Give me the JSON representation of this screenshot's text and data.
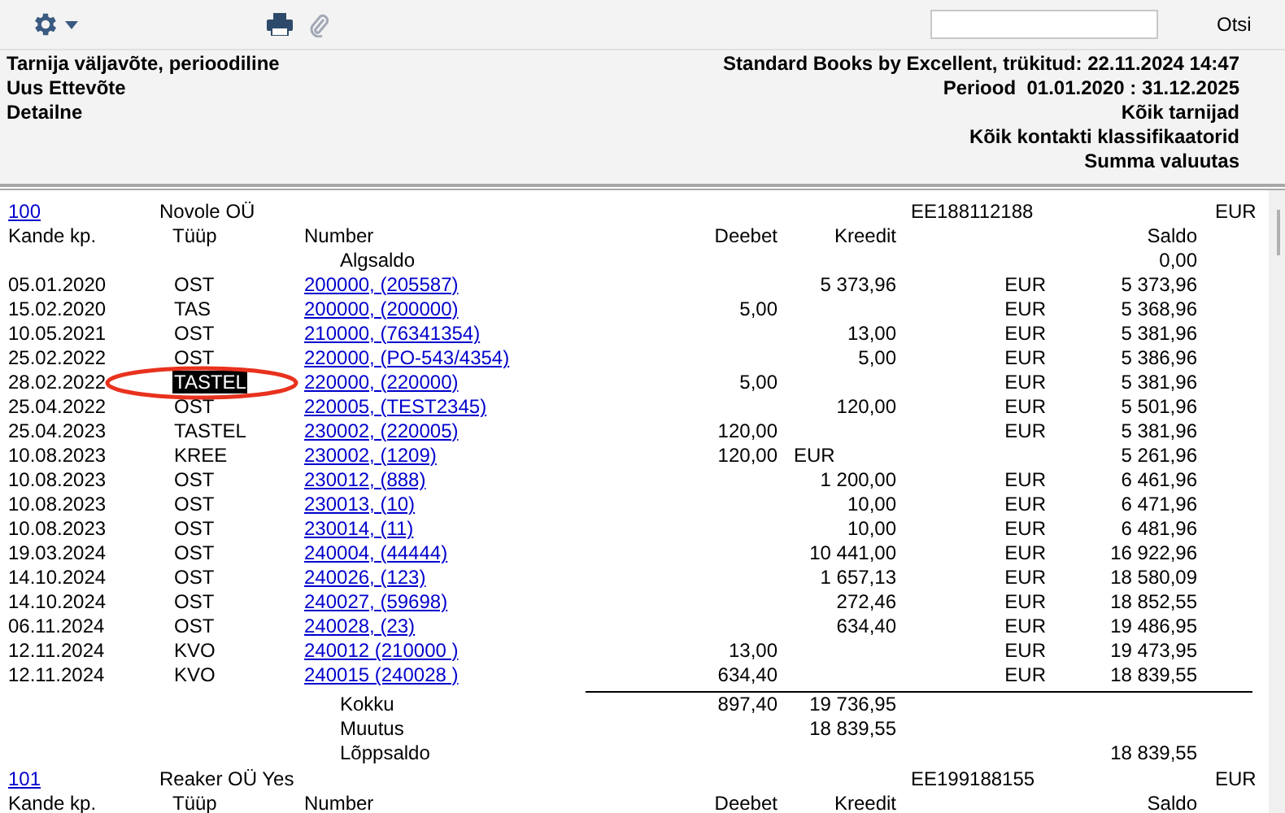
{
  "toolbar": {
    "search_button": "Otsi"
  },
  "report_header": {
    "left": [
      "Tarnija väljavõte, perioodiline",
      "Uus Ettevõte",
      "Detailne"
    ],
    "right": [
      "Standard Books by Excellent, trükitud: 22.11.2024 14:47",
      "Periood  01.01.2020 : 31.12.2025",
      "Kõik tarnijad",
      "Kõik kontakti klassifikaatorid",
      "Summa valuutas"
    ]
  },
  "groups": [
    {
      "code": "100",
      "name": "Novole OÜ",
      "vat_number": "EE188112188",
      "currency": "EUR",
      "columns": [
        "Kande kp.",
        "Tüüp",
        "Number",
        "Deebet",
        "Kreedit",
        "Saldo"
      ],
      "opening": {
        "label": "Algsaldo",
        "saldo": "0,00"
      },
      "rows": [
        {
          "date": "05.01.2020",
          "type": "OST",
          "number": "200000, (205587)",
          "kreedit": "5 373,96",
          "currency": "EUR",
          "saldo": "5 373,96",
          "selected": false
        },
        {
          "date": "15.02.2020",
          "type": "TAS",
          "number": "200000, (200000)",
          "deebet": "5,00",
          "currency": "EUR",
          "saldo": "5 368,96",
          "selected": false
        },
        {
          "date": "10.05.2021",
          "type": "OST",
          "number": "210000, (76341354)",
          "kreedit": "13,00",
          "currency": "EUR",
          "saldo": "5 381,96",
          "selected": false
        },
        {
          "date": "25.02.2022",
          "type": "OST",
          "number": "220000, (PO-543/4354)",
          "kreedit": "5,00",
          "currency": "EUR",
          "saldo": "5 386,96",
          "selected": false
        },
        {
          "date": "28.02.2022",
          "type": "TASTEL",
          "number": "220000, (220000)",
          "deebet": "5,00",
          "currency": "EUR",
          "saldo": "5 381,96",
          "selected": true
        },
        {
          "date": "25.04.2022",
          "type": "OST",
          "number": "220005, (TEST2345)",
          "kreedit": "120,00",
          "currency": "EUR",
          "saldo": "5 501,96",
          "selected": false
        },
        {
          "date": "25.04.2023",
          "type": "TASTEL",
          "number": "230002, (220005)",
          "deebet": "120,00",
          "currency": "EUR",
          "saldo": "5 381,96",
          "selected": false
        },
        {
          "date": "10.08.2023",
          "type": "KREE",
          "number": "230002, (1209)",
          "deebet": "120,00",
          "debit_currency": "EUR",
          "saldo": "5 261,96",
          "selected": false
        },
        {
          "date": "10.08.2023",
          "type": "OST",
          "number": "230012, (888)",
          "kreedit": "1 200,00",
          "currency": "EUR",
          "saldo": "6 461,96",
          "selected": false
        },
        {
          "date": "10.08.2023",
          "type": "OST",
          "number": "230013, (10)",
          "kreedit": "10,00",
          "currency": "EUR",
          "saldo": "6 471,96",
          "selected": false
        },
        {
          "date": "10.08.2023",
          "type": "OST",
          "number": "230014, (11)",
          "kreedit": "10,00",
          "currency": "EUR",
          "saldo": "6 481,96",
          "selected": false
        },
        {
          "date": "19.03.2024",
          "type": "OST",
          "number": "240004, (44444)",
          "kreedit": "10 441,00",
          "currency": "EUR",
          "saldo": "16 922,96",
          "selected": false
        },
        {
          "date": "14.10.2024",
          "type": "OST",
          "number": "240026, (123)",
          "kreedit": "1 657,13",
          "currency": "EUR",
          "saldo": "18 580,09",
          "selected": false
        },
        {
          "date": "14.10.2024",
          "type": "OST",
          "number": "240027, (59698)",
          "kreedit": "272,46",
          "currency": "EUR",
          "saldo": "18 852,55",
          "selected": false
        },
        {
          "date": "06.11.2024",
          "type": "OST",
          "number": "240028, (23)",
          "kreedit": "634,40",
          "currency": "EUR",
          "saldo": "19 486,95",
          "selected": false
        },
        {
          "date": "12.11.2024",
          "type": "KVO",
          "number": "240012 (210000 )",
          "deebet": "13,00",
          "currency": "EUR",
          "saldo": "19 473,95",
          "selected": false
        },
        {
          "date": "12.11.2024",
          "type": "KVO",
          "number": "240015 (240028 )",
          "deebet": "634,40",
          "currency": "EUR",
          "saldo": "18 839,55",
          "selected": false
        }
      ],
      "totals": [
        {
          "label": "Kokku",
          "deebet": "897,40",
          "kreedit": "19 736,95"
        },
        {
          "label": "Muutus",
          "kreedit": "18 839,55"
        },
        {
          "label": "Lõppsaldo",
          "saldo": "18 839,55"
        }
      ]
    },
    {
      "code": "101",
      "name": "Reaker OÜ Yes",
      "vat_number": "EE199188155",
      "currency": "EUR",
      "columns": [
        "Kande kp.",
        "Tüüp",
        "Number",
        "Deebet",
        "Kreedit",
        "Saldo"
      ]
    }
  ]
}
